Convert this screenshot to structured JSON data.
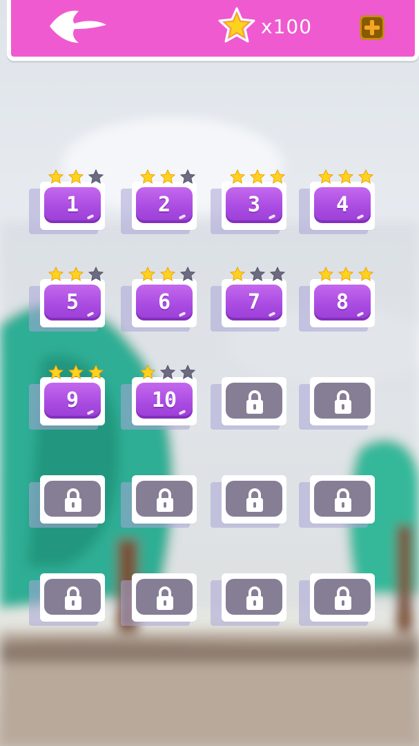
{
  "header": {
    "coins": "x100"
  },
  "icons": {
    "back": "back-arrow-icon",
    "star": "star-icon",
    "add": "plus-icon",
    "lock": "padlock-icon"
  },
  "colors": {
    "topbar": "#f05ad0",
    "level_button": "#b04ee4",
    "locked_button": "#867e95",
    "star_on": "#ffd21f",
    "star_off": "#6d6b80"
  },
  "levels": [
    {
      "label": "1",
      "stars": 2
    },
    {
      "label": "2",
      "stars": 2
    },
    {
      "label": "3",
      "stars": 3
    },
    {
      "label": "4",
      "stars": 3
    },
    {
      "label": "5",
      "stars": 2
    },
    {
      "label": "6",
      "stars": 2
    },
    {
      "label": "7",
      "stars": 1
    },
    {
      "label": "8",
      "stars": 3
    },
    {
      "label": "9",
      "stars": 3
    },
    {
      "label": "10",
      "stars": 1
    },
    {
      "locked": true
    },
    {
      "locked": true
    },
    {
      "locked": true
    },
    {
      "locked": true
    },
    {
      "locked": true
    },
    {
      "locked": true
    },
    {
      "locked": true
    },
    {
      "locked": true
    },
    {
      "locked": true
    },
    {
      "locked": true
    }
  ]
}
